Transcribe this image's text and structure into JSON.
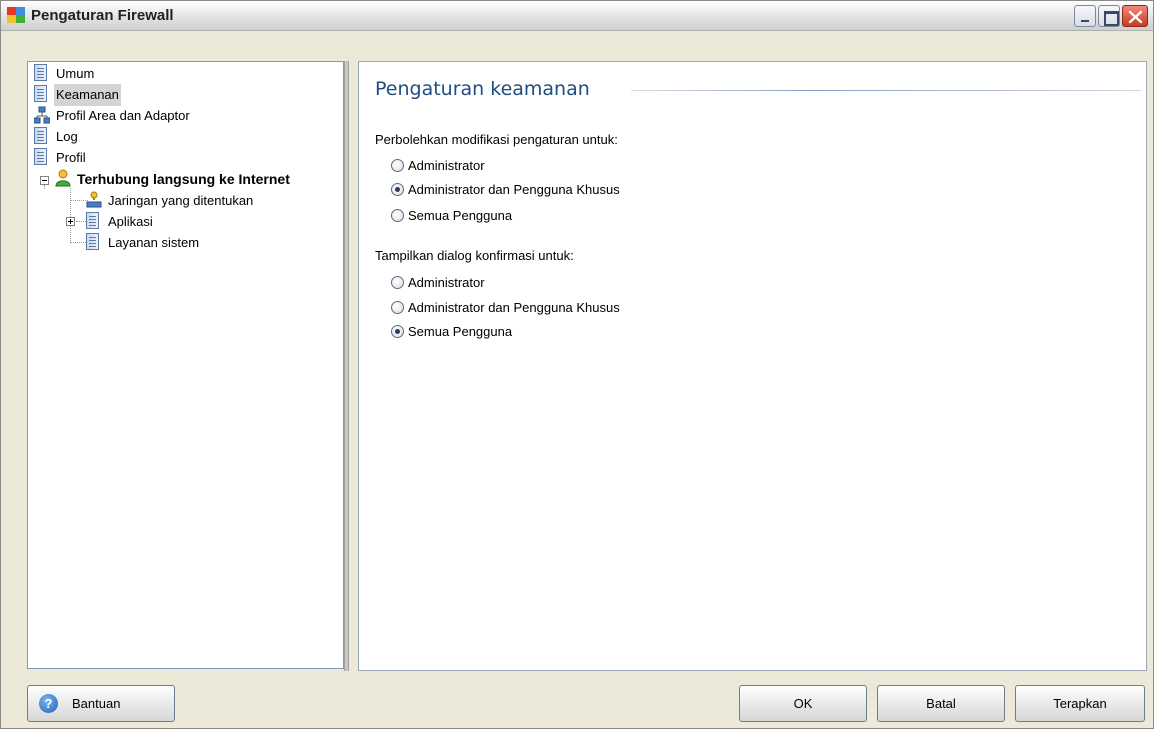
{
  "window": {
    "title": "Pengaturan Firewall"
  },
  "tree": {
    "items": [
      {
        "label": "Umum",
        "icon": "document-icon"
      },
      {
        "label": "Keamanan",
        "icon": "document-icon",
        "selected": true
      },
      {
        "label": "Profil Area dan Adaptor",
        "icon": "network-icon"
      },
      {
        "label": "Log",
        "icon": "document-icon"
      },
      {
        "label": "Profil",
        "icon": "document-icon"
      },
      {
        "label": "Terhubung langsung ke Internet",
        "icon": "user-icon",
        "expanded": true
      },
      {
        "label": "Jaringan yang ditentukan",
        "icon": "network-icon"
      },
      {
        "label": "Aplikasi",
        "icon": "document-icon",
        "expandable": true
      },
      {
        "label": "Layanan sistem",
        "icon": "document-icon"
      }
    ]
  },
  "content": {
    "title": "Pengaturan keamanan",
    "section1": {
      "label": "Perbolehkan modifikasi pengaturan untuk:",
      "options": [
        {
          "label": "Administrator",
          "checked": false
        },
        {
          "label": "Administrator dan Pengguna Khusus",
          "checked": true
        },
        {
          "label": "Semua Pengguna",
          "checked": false
        }
      ]
    },
    "section2": {
      "label": "Tampilkan dialog konfirmasi untuk:",
      "options": [
        {
          "label": "Administrator",
          "checked": false
        },
        {
          "label": "Administrator dan Pengguna Khusus",
          "checked": false
        },
        {
          "label": "Semua Pengguna",
          "checked": true
        }
      ]
    }
  },
  "buttons": {
    "help": "Bantuan",
    "ok": "OK",
    "cancel": "Batal",
    "apply": "Terapkan"
  }
}
